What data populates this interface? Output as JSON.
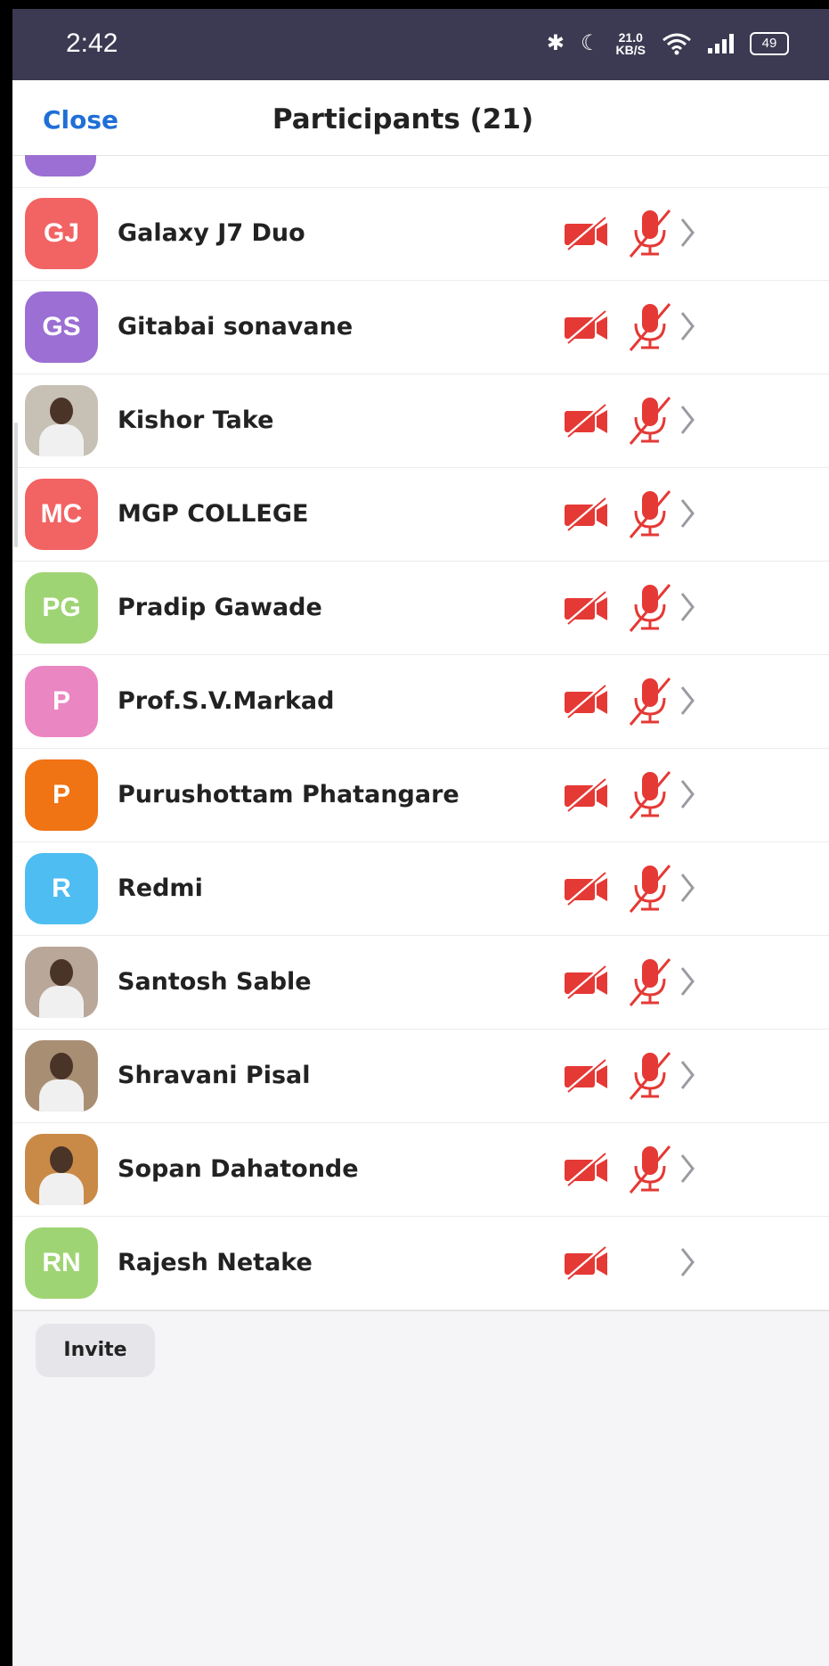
{
  "status_bar": {
    "time": "2:42",
    "bluetooth": "✱",
    "moon": "☾",
    "speed_value": "21.0",
    "speed_unit": "KB/S",
    "battery": "49"
  },
  "header": {
    "close_label": "Close",
    "title": "Participants (21)"
  },
  "colors": {
    "muted_red": "#e53935",
    "link_blue": "#1f6fd6"
  },
  "participants": [
    {
      "initials": "GJ",
      "name": "Galaxy J7 Duo",
      "avatar_color": "#f26363",
      "photo": false,
      "video_muted": true,
      "audio_muted": true
    },
    {
      "initials": "GS",
      "name": "Gitabai sonavane",
      "avatar_color": "#9b6fd3",
      "photo": false,
      "video_muted": true,
      "audio_muted": true
    },
    {
      "initials": "",
      "name": "Kishor Take",
      "avatar_color": "#c7c0b4",
      "photo": true,
      "video_muted": true,
      "audio_muted": true
    },
    {
      "initials": "MC",
      "name": "MGP COLLEGE",
      "avatar_color": "#f26363",
      "photo": false,
      "video_muted": true,
      "audio_muted": true
    },
    {
      "initials": "PG",
      "name": "Pradip Gawade",
      "avatar_color": "#9fd474",
      "photo": false,
      "video_muted": true,
      "audio_muted": true
    },
    {
      "initials": "P",
      "name": "Prof.S.V.Markad",
      "avatar_color": "#ea86c2",
      "photo": false,
      "video_muted": true,
      "audio_muted": true
    },
    {
      "initials": "P",
      "name": "Purushottam Phatangare",
      "avatar_color": "#f07314",
      "photo": false,
      "video_muted": true,
      "audio_muted": true
    },
    {
      "initials": "R",
      "name": "Redmi",
      "avatar_color": "#4dbdf2",
      "photo": false,
      "video_muted": true,
      "audio_muted": true
    },
    {
      "initials": "",
      "name": "Santosh Sable",
      "avatar_color": "#b9a79a",
      "photo": true,
      "video_muted": true,
      "audio_muted": true
    },
    {
      "initials": "",
      "name": "Shravani Pisal",
      "avatar_color": "#a88f74",
      "photo": true,
      "video_muted": true,
      "audio_muted": true
    },
    {
      "initials": "",
      "name": "Sopan Dahatonde",
      "avatar_color": "#c98a47",
      "photo": true,
      "video_muted": true,
      "audio_muted": true
    },
    {
      "initials": "RN",
      "name": "Rajesh Netake",
      "avatar_color": "#9fd474",
      "photo": false,
      "video_muted": true,
      "audio_muted": false
    }
  ],
  "footer": {
    "invite_label": "Invite"
  }
}
